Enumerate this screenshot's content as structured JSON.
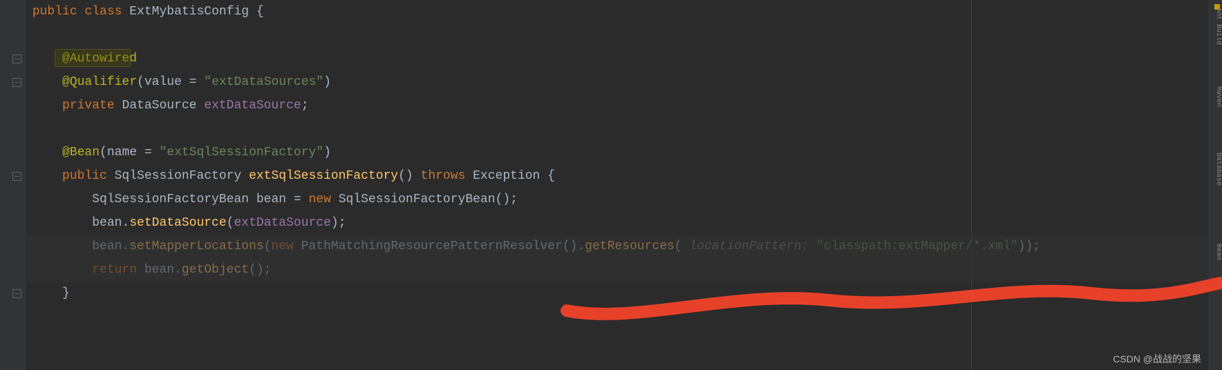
{
  "code": {
    "l1_public": "public",
    "l1_class": "class",
    "l1_name": "ExtMybatisConfig",
    "l1_brace": " {",
    "l3_autowired": "@Autowired",
    "l4_qualifier": "@Qualifier",
    "l4_open": "(",
    "l4_value": "value",
    "l4_eq": " = ",
    "l4_str": "\"extDataSources\"",
    "l4_close": ")",
    "l5_private": "private",
    "l5_type": " DataSource ",
    "l5_field": "extDataSource",
    "l5_semi": ";",
    "l7_bean": "@Bean",
    "l7_open": "(",
    "l7_name": "name",
    "l7_eq": " = ",
    "l7_str": "\"extSqlSessionFactory\"",
    "l7_close": ")",
    "l8_public": "public",
    "l8_rtype": " SqlSessionFactory ",
    "l8_meth": "extSqlSessionFactory",
    "l8_paren": "() ",
    "l8_throws": "throws",
    "l8_ex": " Exception {",
    "l9_pre": "SqlSessionFactoryBean bean = ",
    "l9_new": "new",
    "l9_post": " SqlSessionFactoryBean();",
    "l10_a": "bean.",
    "l10_m": "setDataSource",
    "l10_o": "(",
    "l10_f": "extDataSource",
    "l10_c": ");",
    "l11_a": "bean.",
    "l11_m": "setMapperLocations",
    "l11_o": "(",
    "l11_new": "new",
    "l11_class": " PathMatchingResourcePatternResolver().",
    "l11_m2": "getResources",
    "l11_o2": "( ",
    "l11_hint": "locationPattern: ",
    "l11_str": "\"classpath:extMapper/*.xml\"",
    "l11_c": "));",
    "l12_ret": "return",
    "l12_b": " bean.",
    "l12_m": "getObject",
    "l12_c": "();",
    "l13_close": "}"
  },
  "tools": {
    "t1": "Ant Build",
    "t2": "Maven",
    "t3": "Database",
    "t4": "Bean"
  },
  "watermark": "CSDN @战战的坚果",
  "colors": {
    "marker": "#cc9900"
  }
}
